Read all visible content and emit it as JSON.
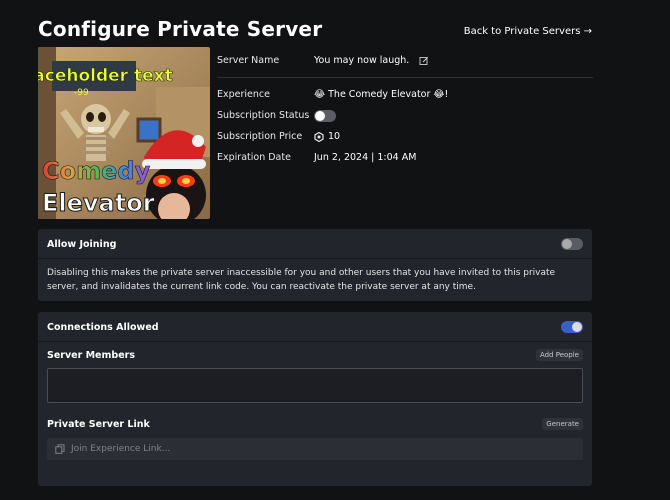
{
  "header": {
    "title": "Configure Private Server",
    "back_link": "Back to Private Servers →"
  },
  "thumbnail": {
    "caption_top": "placeholder text",
    "caption_line1": "Comedy",
    "caption_line2": "Elevator"
  },
  "details": {
    "server_name_label": "Server Name",
    "server_name_value": "You may now laugh.",
    "experience_label": "Experience",
    "experience_value": "😂 The Comedy Elevator 😂!",
    "subscription_status_label": "Subscription Status",
    "subscription_status_on": false,
    "subscription_price_label": "Subscription Price",
    "subscription_price_value": "10",
    "expiration_label": "Expiration Date",
    "expiration_value": "Jun 2, 2024 | 1:04 AM"
  },
  "allow_joining": {
    "label": "Allow Joining",
    "enabled": false,
    "description": "Disabling this makes the private server inaccessible for you and other users that you have invited to this private server, and invalidates the current link code. You can reactivate the private server at any time."
  },
  "connections": {
    "label": "Connections Allowed",
    "enabled": true,
    "members_label": "Server Members",
    "add_people_label": "Add People",
    "link_label": "Private Server Link",
    "generate_label": "Generate",
    "link_placeholder": "Join Experience Link..."
  },
  "colors": {
    "background": "#111214",
    "panel": "#23252c",
    "toggle_on": "#3c5ec9"
  }
}
